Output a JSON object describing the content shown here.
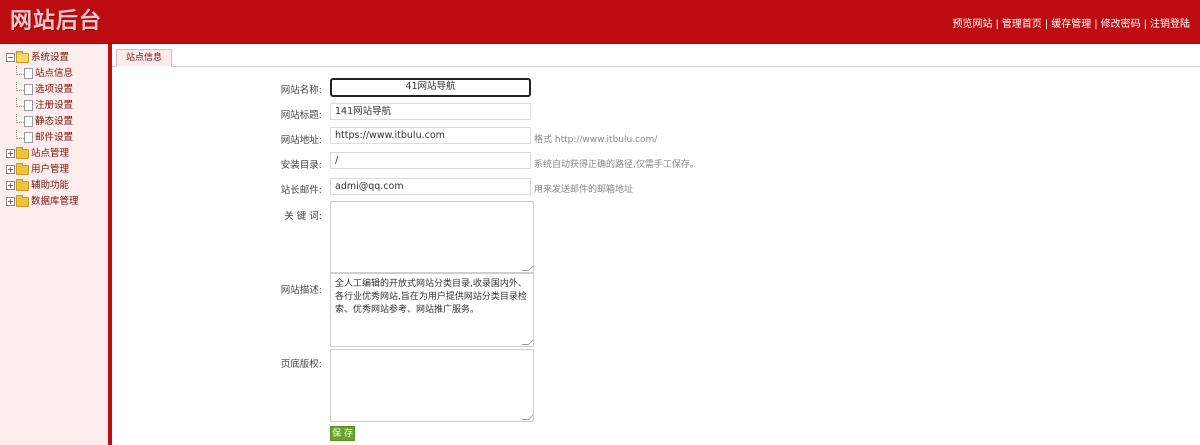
{
  "header": {
    "logo": "网站后台",
    "nav": [
      "预览网站",
      "管理首页",
      "缓存管理",
      "修改密码",
      "注销登陆"
    ],
    "separator": "|"
  },
  "sidebar": {
    "groups": [
      {
        "label": "系统设置",
        "expanded": true,
        "toggle": "−",
        "children": [
          "站点信息",
          "选项设置",
          "注册设置",
          "静态设置",
          "邮件设置"
        ]
      },
      {
        "label": "站点管理",
        "expanded": false,
        "toggle": "+"
      },
      {
        "label": "用户管理",
        "expanded": false,
        "toggle": "+"
      },
      {
        "label": "辅助功能",
        "expanded": false,
        "toggle": "+"
      },
      {
        "label": "数据库管理",
        "expanded": false,
        "toggle": "+"
      }
    ]
  },
  "tab": {
    "label": "站点信息"
  },
  "form": {
    "site_name_label": "网站名称:",
    "site_name_value": "41网站导航",
    "site_title_label": "网站标题:",
    "site_title_value": "141网站导航",
    "site_url_label": "网站地址:",
    "site_url_value": "https://www.itbulu.com",
    "site_url_hint": "格式 http://www.itbulu.com/",
    "install_dir_label": "安装目录:",
    "install_dir_value": "/",
    "install_dir_hint": "系统自动获得正确的路径,仅需手工保存。",
    "admin_email_label": "站长邮件:",
    "admin_email_value": "admi@qq.com",
    "admin_email_hint": "用来发送邮件的邮箱地址",
    "keywords_label": "关 键 词:",
    "keywords_value": "",
    "description_label": "网站描述:",
    "description_value": "全人工编辑的开放式网站分类目录,收录国内外、各行业优秀网站,旨在为用户提供网站分类目录检索、优秀网站参考、网站推广服务。",
    "copyright_label": "页底版权:",
    "copyright_value": "",
    "save_label": "保 存"
  },
  "colors": {
    "header_bg": "#be0d12",
    "sidebar_bg": "#fdeeee",
    "save_button": "#6aa52a"
  }
}
